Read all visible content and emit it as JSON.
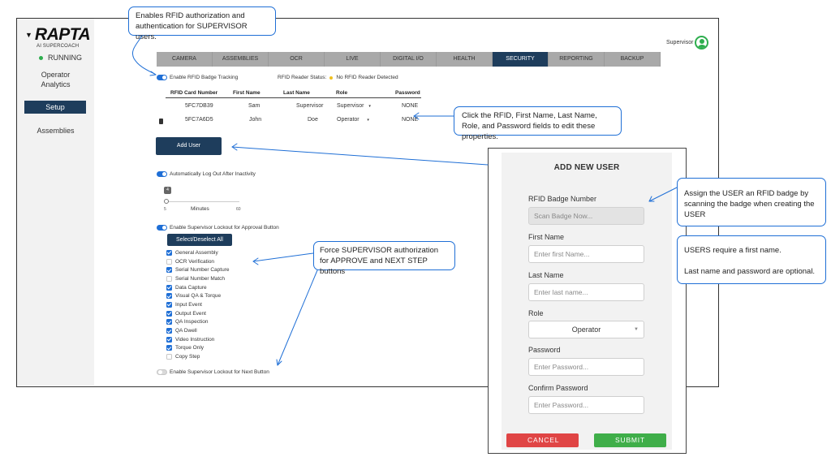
{
  "brand": {
    "name": "RAPTA",
    "subtitle": "AI SUPERCOACH"
  },
  "status": {
    "label": "RUNNING",
    "color": "#2eae4e"
  },
  "user": {
    "name": "Supervisor",
    "icon": "user-avatar-icon"
  },
  "sidebar": {
    "items": [
      {
        "label": "Operator Analytics"
      },
      {
        "label": "Setup",
        "active": true
      },
      {
        "label": "Assemblies"
      }
    ]
  },
  "tabs": [
    {
      "label": "CAMERA"
    },
    {
      "label": "ASSEMBLIES"
    },
    {
      "label": "OCR"
    },
    {
      "label": "LIVE"
    },
    {
      "label": "DIGITAL I/O"
    },
    {
      "label": "HEALTH"
    },
    {
      "label": "SECURITY",
      "active": true
    },
    {
      "label": "REPORTING"
    },
    {
      "label": "BACKUP"
    }
  ],
  "security": {
    "rfid_toggle_label": "Enable RFID Badge Tracking",
    "rfid_toggle_on": true,
    "reader_status_label": "RFID Reader Status:",
    "reader_status_value": "No RFID Reader Detected",
    "reader_status_color": "#f0c020",
    "table": {
      "headers": [
        "RFID Card Number",
        "First Name",
        "Last Name",
        "Role",
        "Password"
      ],
      "rows": [
        {
          "rfid": "5FC7DB39",
          "first": "Sam",
          "last": "Supervisor",
          "role": "Supervisor",
          "password": "NONE"
        },
        {
          "rfid": "5FC7A6D5",
          "first": "John",
          "last": "Doe",
          "role": "Operator",
          "password": "NONE"
        }
      ]
    },
    "add_user_label": "Add User",
    "auto_logout_label": "Automatically Log Out After Inactivity",
    "auto_logout_on": true,
    "slider": {
      "value": "4",
      "min": "5",
      "max": "60",
      "unit": "Minutes"
    },
    "lockout_approval_label": "Enable Supervisor Lockout for Approval Button",
    "lockout_approval_on": true,
    "select_all_label": "Select/Deselect All",
    "steps": [
      {
        "label": "General Assembly",
        "checked": true
      },
      {
        "label": "OCR Verification",
        "checked": false
      },
      {
        "label": "Serial Number Capture",
        "checked": true
      },
      {
        "label": "Serial Number Match",
        "checked": false
      },
      {
        "label": "Data Capture",
        "checked": true
      },
      {
        "label": "Visual QA & Torque",
        "checked": true
      },
      {
        "label": "Input Event",
        "checked": true
      },
      {
        "label": "Output Event",
        "checked": true
      },
      {
        "label": "QA Inspection",
        "checked": true
      },
      {
        "label": "QA Dwell",
        "checked": true
      },
      {
        "label": "Video Instruction",
        "checked": true
      },
      {
        "label": "Torque Only",
        "checked": true
      },
      {
        "label": "Copy Step",
        "checked": false
      }
    ],
    "lockout_next_label": "Enable Supervisor Lockout for Next Button",
    "lockout_next_on": false
  },
  "modal": {
    "title": "ADD NEW USER",
    "rfid_label": "RFID Badge Number",
    "rfid_placeholder": "Scan Badge Now...",
    "first_label": "First Name",
    "first_placeholder": "Enter first Name...",
    "last_label": "Last Name",
    "last_placeholder": "Enter last name...",
    "role_label": "Role",
    "role_value": "Operator",
    "password_label": "Password",
    "password_placeholder": "Enter Password...",
    "confirm_label": "Confirm Password",
    "confirm_placeholder": "Enter Password...",
    "cancel_label": "CANCEL",
    "submit_label": "SUBMIT",
    "cancel_color": "#e04545",
    "submit_color": "#3fae49"
  },
  "callouts": {
    "rfid_auth": "Enables RFID authorization and authentication for SUPERVISOR users.",
    "edit_fields": "Click the RFID, First Name, Last Name, Role, and Password fields to edit these properties.",
    "badge_assign": "Assign the USER an RFID badge by scanning the badge when creating the USER",
    "first_name_req": "USERS require a first name.",
    "optional": "Last name and password are optional.",
    "force_auth": "Force SUPERVISOR authorization for APPROVE and NEXT STEP buttons"
  },
  "colors": {
    "nav_dark": "#1e3d5c",
    "accent_blue": "#1f6fd6",
    "callout_border": "#1f6fd6"
  }
}
